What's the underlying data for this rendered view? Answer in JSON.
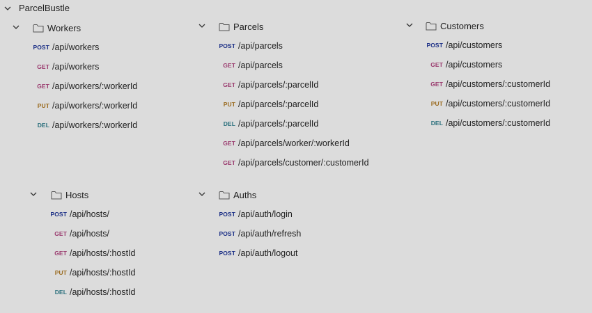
{
  "collection": {
    "name": "ParcelBustle"
  },
  "folders": {
    "workers": {
      "name": "Workers",
      "requests": [
        {
          "method": "POST",
          "path": "/api/workers"
        },
        {
          "method": "GET",
          "path": "/api/workers"
        },
        {
          "method": "GET",
          "path": "/api/workers/:workerId"
        },
        {
          "method": "PUT",
          "path": "/api/workers/:workerId"
        },
        {
          "method": "DEL",
          "path": "/api/workers/:workerId"
        }
      ]
    },
    "parcels": {
      "name": "Parcels",
      "requests": [
        {
          "method": "POST",
          "path": "/api/parcels"
        },
        {
          "method": "GET",
          "path": "/api/parcels"
        },
        {
          "method": "GET",
          "path": "/api/parcels/:parcelId"
        },
        {
          "method": "PUT",
          "path": "/api/parcels/:parcelId"
        },
        {
          "method": "DEL",
          "path": "/api/parcels/:parcelId"
        },
        {
          "method": "GET",
          "path": "/api/parcels/worker/:workerId"
        },
        {
          "method": "GET",
          "path": "/api/parcels/customer/:customerId"
        }
      ]
    },
    "customers": {
      "name": "Customers",
      "requests": [
        {
          "method": "POST",
          "path": "/api/customers"
        },
        {
          "method": "GET",
          "path": "/api/customers"
        },
        {
          "method": "GET",
          "path": "/api/customers/:customerId"
        },
        {
          "method": "PUT",
          "path": "/api/customers/:customerId"
        },
        {
          "method": "DEL",
          "path": "/api/customers/:customerId"
        }
      ]
    },
    "hosts": {
      "name": "Hosts",
      "requests": [
        {
          "method": "POST",
          "path": "/api/hosts/"
        },
        {
          "method": "GET",
          "path": "/api/hosts/"
        },
        {
          "method": "GET",
          "path": "/api/hosts/:hostId"
        },
        {
          "method": "PUT",
          "path": "/api/hosts/:hostId"
        },
        {
          "method": "DEL",
          "path": "/api/hosts/:hostId"
        }
      ]
    },
    "auths": {
      "name": "Auths",
      "requests": [
        {
          "method": "POST",
          "path": "/api/auth/login"
        },
        {
          "method": "POST",
          "path": "/api/auth/refresh"
        },
        {
          "method": "POST",
          "path": "/api/auth/logout"
        }
      ]
    }
  },
  "colors": {
    "background": "#dcdcdc",
    "post": "#1b2f86",
    "get": "#9a3a6e",
    "put": "#9a6a1e",
    "del": "#2a6f7c"
  },
  "icons": {
    "collapse": "chevron-down-icon",
    "folder": "folder-icon"
  }
}
